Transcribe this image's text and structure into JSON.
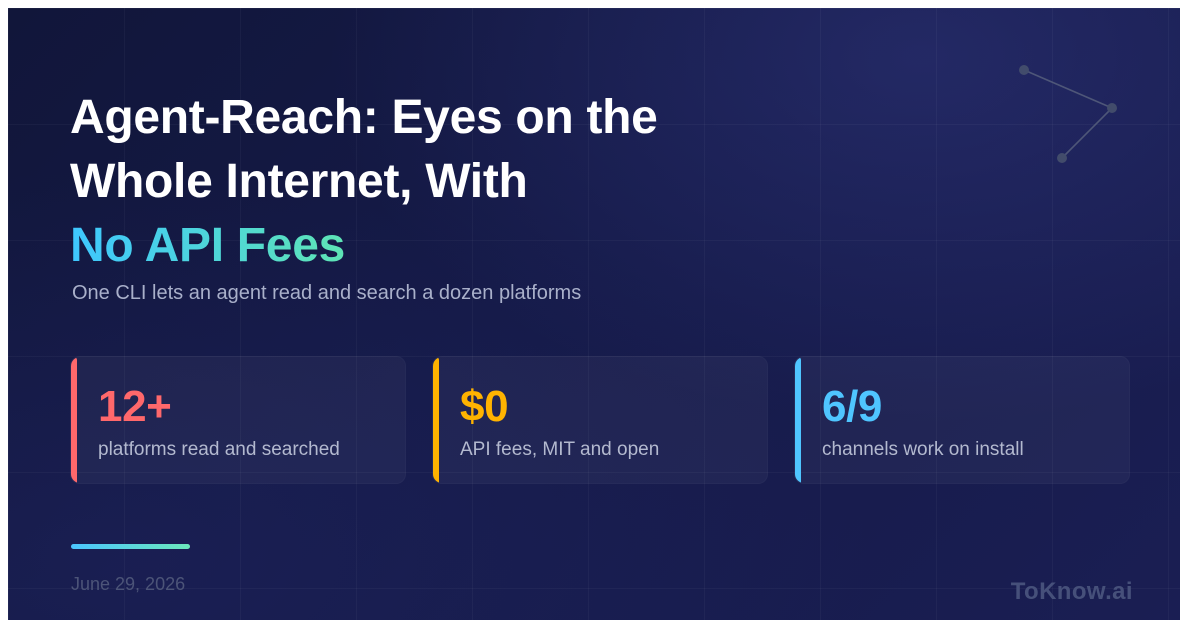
{
  "headline": {
    "line_1": "Agent-Reach: Eyes on the",
    "line_2": "Whole Internet, With",
    "highlight": "No API Fees"
  },
  "subtitle": "One CLI lets an agent read and search a dozen platforms",
  "stats": [
    {
      "value": "12+",
      "label": "platforms read and searched",
      "accent_color": "#ff686b",
      "value_color": "#ff686b"
    },
    {
      "value": "$0",
      "label": "API fees, MIT and open",
      "accent_color": "#ffb300",
      "value_color": "#ffb300"
    },
    {
      "value": "6/9",
      "label": "channels work on install",
      "accent_color": "#4fc5ff",
      "value_color": "#4fc5ff"
    }
  ],
  "date": "June 29, 2026",
  "brand": "ToKnow.ai",
  "decorations": {
    "network_icon": "network-nodes-icon"
  },
  "colors": {
    "background": "#151a48",
    "highlight_start": "#3ec7ff",
    "highlight_end": "#5ee4b5"
  }
}
